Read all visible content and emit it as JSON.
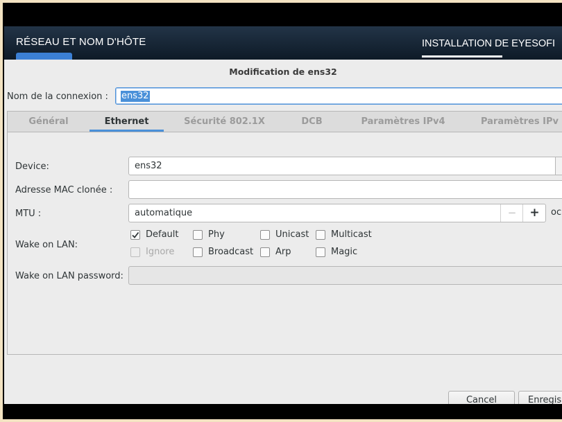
{
  "header": {
    "title": "RÉSEAU ET NOM D'HÔTE",
    "install_title": "INSTALLATION DE EYESOFI"
  },
  "dialog": {
    "title": "Modification de ens32",
    "connection_name_label": "Nom de la connexion :",
    "connection_name_value": "ens32"
  },
  "tabs": [
    {
      "label": "Général",
      "active": false
    },
    {
      "label": "Ethernet",
      "active": true
    },
    {
      "label": "Sécurité 802.1X",
      "active": false
    },
    {
      "label": "DCB",
      "active": false
    },
    {
      "label": "Paramètres IPv4",
      "active": false
    },
    {
      "label": "Paramètres IPv",
      "active": false
    }
  ],
  "ethernet": {
    "device_label": "Device:",
    "device_value": "ens32",
    "mac_label": "Adresse MAC clonée :",
    "mac_value": "",
    "mtu_label": "MTU :",
    "mtu_value": "automatique",
    "mtu_minus": "−",
    "mtu_plus": "+",
    "mtu_unit": "oc",
    "wol_label": "Wake on LAN:",
    "wol_options": [
      {
        "label": "Default",
        "checked": true,
        "disabled": false
      },
      {
        "label": "Phy",
        "checked": false,
        "disabled": false
      },
      {
        "label": "Unicast",
        "checked": false,
        "disabled": false
      },
      {
        "label": "Multicast",
        "checked": false,
        "disabled": false
      },
      {
        "label": "Ignore",
        "checked": false,
        "disabled": true
      },
      {
        "label": "Broadcast",
        "checked": false,
        "disabled": false
      },
      {
        "label": "Arp",
        "checked": false,
        "disabled": false
      },
      {
        "label": "Magic",
        "checked": false,
        "disabled": false
      }
    ],
    "wol_password_label": "Wake on LAN password:",
    "wol_password_value": ""
  },
  "buttons": {
    "cancel": "Cancel",
    "save": "Enregis"
  },
  "colors": {
    "accent": "#4a90d9",
    "header_bg": "#1a2a3a"
  }
}
